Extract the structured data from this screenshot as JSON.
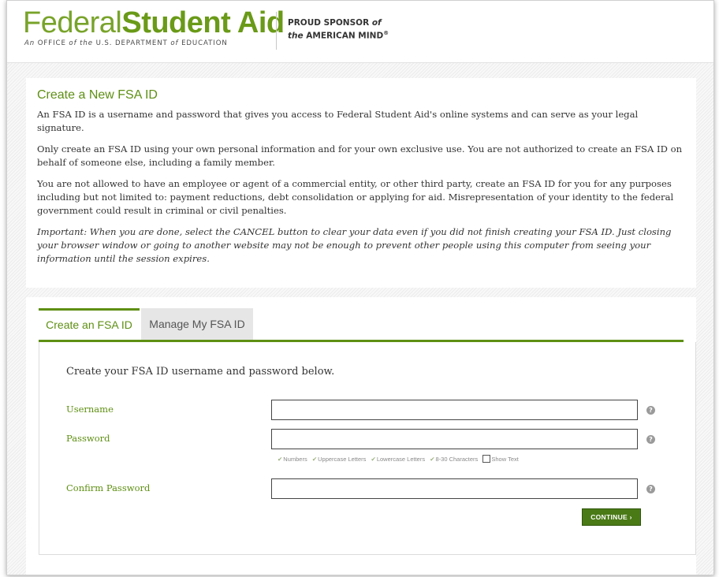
{
  "header": {
    "logo_word_1": "Federal",
    "logo_word_2": "Student Aid",
    "logo_sub_1": "An ",
    "logo_sub_2": "OFFICE",
    "logo_sub_3": " of the ",
    "logo_sub_4": "U.S. DEPARTMENT",
    "logo_sub_5": " of ",
    "logo_sub_6": "EDUCATION",
    "sponsor_line_1": "PROUD SPONSOR ",
    "sponsor_of": "of",
    "sponsor_the": "the",
    "sponsor_line_2": " AMERICAN MIND",
    "sponsor_reg": "®"
  },
  "intro": {
    "title": "Create a New FSA ID",
    "p1": "An FSA ID is a username and password that gives you access to Federal Student Aid's online systems and can serve as your legal signature.",
    "p2": "Only create an FSA ID using your own personal information and for your own exclusive use. You are not authorized to create an FSA ID on behalf of someone else, including a family member.",
    "p3": "You are not allowed to have an employee or agent of a commercial entity, or other third party, create an FSA ID for you for any purposes including but not limited to: payment reductions, debt consolidation or applying for aid. Misrepresentation of your identity to the federal government could result in criminal or civil penalties.",
    "p4": "Important: When you are done, select the CANCEL button to clear your data even if you did not finish creating your FSA ID. Just closing your browser window or going to another website may not be enough to prevent other people using this computer from seeing your information until the session expires."
  },
  "tabs": {
    "active": "Create an FSA ID",
    "inactive": "Manage My FSA ID"
  },
  "form": {
    "intro": "Create your FSA ID username and password below.",
    "username_label": "Username",
    "username_value": "",
    "password_label": "Password",
    "password_value": "",
    "confirm_label": "Confirm Password",
    "confirm_value": "",
    "help_glyph": "?",
    "check_glyph": "✔",
    "req_numbers": "Numbers",
    "req_upper": "Uppercase Letters",
    "req_lower": "Lowercase Letters",
    "req_length": "8-30 Characters",
    "show_text": "Show Text",
    "continue_label": "CONTINUE ›"
  },
  "colors": {
    "brand_green": "#5e8f13",
    "button_green": "#4a7a16"
  }
}
